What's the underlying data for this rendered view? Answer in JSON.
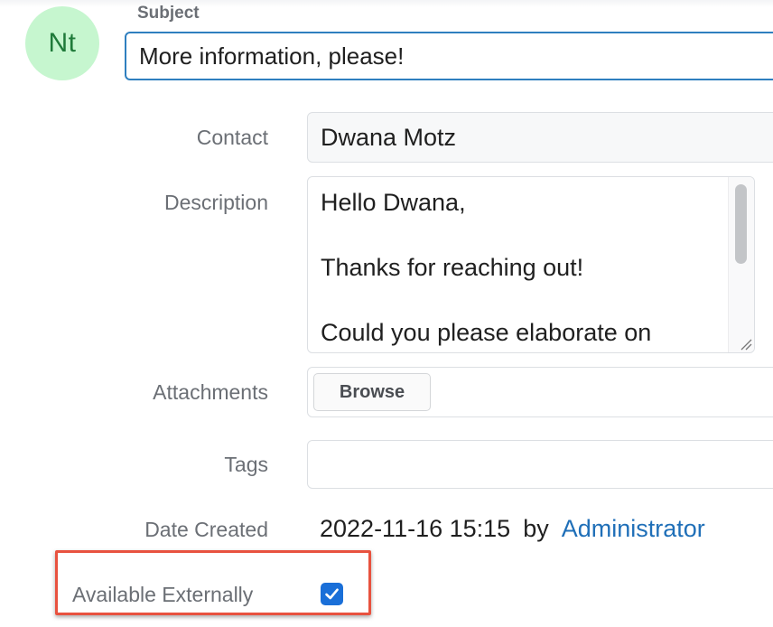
{
  "header": {
    "avatar_initials": "Nt",
    "avatar_color": "#c6f6cf",
    "subject_label": "Subject",
    "subject_value": "More information, please!"
  },
  "form": {
    "contact": {
      "label": "Contact",
      "value": "Dwana Motz"
    },
    "description": {
      "label": "Description",
      "value": "Hello Dwana,\n\nThanks for reaching out!\n\nCould you please elaborate on"
    },
    "attachments": {
      "label": "Attachments",
      "button_label": "Browse"
    },
    "tags": {
      "label": "Tags",
      "value": ""
    },
    "date_created": {
      "label": "Date Created",
      "value": "2022-11-16 15:15",
      "by_text": "by",
      "author": "Administrator"
    },
    "available_externally": {
      "label": "Available Externally",
      "checked": true
    }
  },
  "colors": {
    "accent": "#2f7fbf",
    "link": "#1f6fb8",
    "checkbox": "#1a6fd8",
    "highlight_border": "#e8523f"
  }
}
